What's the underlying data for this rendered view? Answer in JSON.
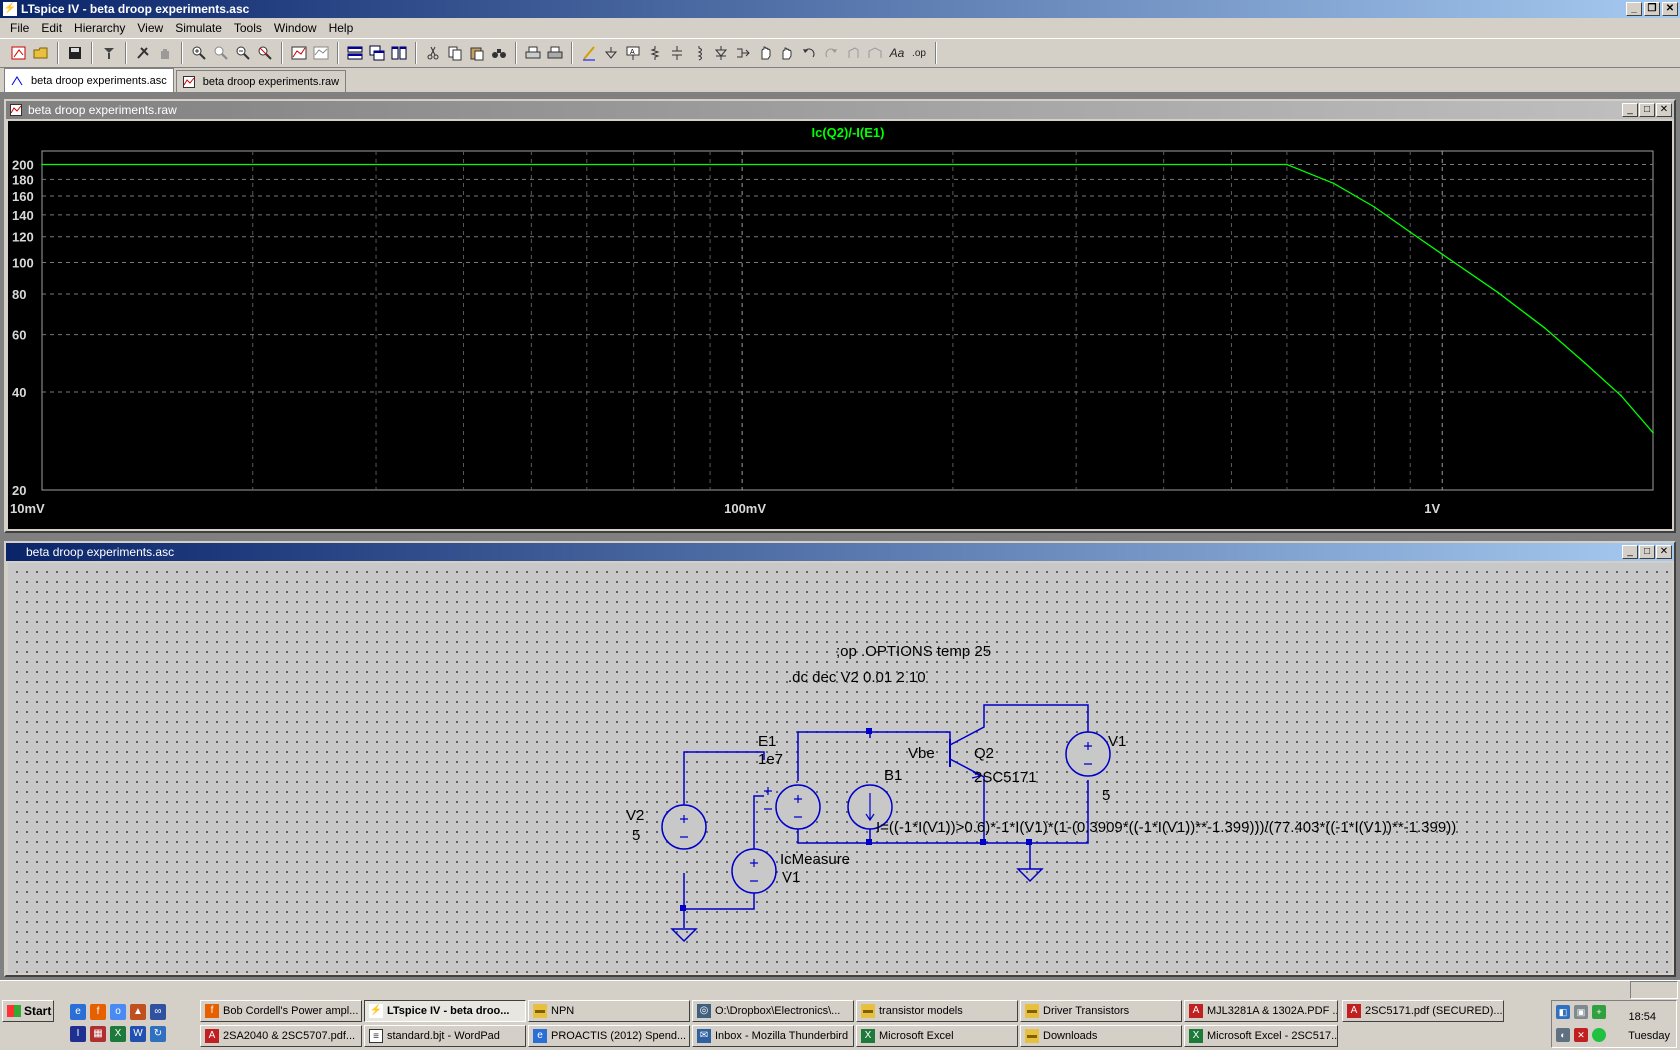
{
  "window": {
    "title": "LTspice IV - beta droop experiments.asc",
    "controls": [
      "_",
      "❐",
      "✕"
    ]
  },
  "menu": [
    "File",
    "Edit",
    "Hierarchy",
    "View",
    "Simulate",
    "Tools",
    "Window",
    "Help"
  ],
  "toolbar": {
    "icons": [
      "run-icon",
      "open-icon",
      "save-icon",
      "control-panel-icon",
      "halt-icon",
      "pan-icon",
      "zoom-in-icon",
      "zoom-fit-icon",
      "zoom-out-icon",
      "zoom-cancel-icon",
      "autorange-icon",
      "waveform-icon",
      "tile-horizontal-icon",
      "cascade-icon",
      "tile-vertical-icon",
      "cut-icon",
      "copy-icon",
      "paste-icon",
      "find-icon",
      "print-setup-icon",
      "print-icon",
      "draw-wire-icon",
      "ground-icon",
      "label-net-icon",
      "resistor-icon",
      "capacitor-icon",
      "inductor-icon",
      "diode-icon",
      "component-icon",
      "move-icon",
      "drag-icon",
      "undo-icon",
      "redo-icon",
      "rotate-icon",
      "mirror-icon",
      "text-icon",
      "spice-directive-icon"
    ],
    "text_glyphs": {
      "text": "Aa",
      "op": ".op"
    }
  },
  "tabs": [
    {
      "label": "beta droop experiments.asc",
      "active": true,
      "icon": "schematic-icon"
    },
    {
      "label": "beta droop experiments.raw",
      "active": false,
      "icon": "waveform-icon"
    }
  ],
  "waveform_window": {
    "title": "beta droop experiments.raw",
    "trace_label": "Ic(Q2)/-I(E1)",
    "trace_color": "#00ff00",
    "y_ticks": [
      "200",
      "180",
      "160",
      "140",
      "120",
      "100",
      "80",
      "60",
      "40",
      "20"
    ],
    "x_ticks": [
      "10mV",
      "100mV",
      "1V"
    ]
  },
  "chart_data": {
    "type": "line",
    "title": "Ic(Q2)/-I(E1)",
    "xlabel": "",
    "ylabel": "",
    "x_scale": "log",
    "y_scale": "log",
    "xlim": [
      0.01,
      2
    ],
    "ylim": [
      20,
      220
    ],
    "grid": true,
    "series": [
      {
        "name": "Ic(Q2)/-I(E1)",
        "color": "#00ff00",
        "x": [
          0.01,
          0.1,
          0.5,
          0.6,
          0.7,
          0.8,
          0.9,
          1.0,
          1.2,
          1.4,
          1.6,
          1.8,
          2.0
        ],
        "y": [
          200,
          200,
          200,
          200,
          175,
          148,
          124,
          106,
          81,
          63,
          49,
          39,
          30
        ]
      }
    ]
  },
  "schematic_window": {
    "title": "beta droop experiments.asc",
    "directives": {
      "op_options": ";op   .OPTIONS temp 25",
      "dc": ".dc dec V2 0.01 2 10"
    },
    "labels": {
      "E1_name": "E1",
      "E1_value": "1e7",
      "B1_name": "B1",
      "vbe_net": "Vbe",
      "Q2_name": "Q2",
      "Q2_model": "2SC5171",
      "V1_name": "V1",
      "V1_value": "5",
      "V2_name": "V2",
      "V2_value": "5",
      "icmeasure_name": "IcMeasure",
      "icmeasure_value": "V1",
      "B1_expr": "I=((-1*I(V1))>0.6)*-1*I(V1)*(1-(0.3909*((-1*I(V1))**-1.399)))/(77.403*((-1*I(V1))**-1.399))"
    },
    "wire_color": "#0000c8"
  },
  "taskbar": {
    "start_label": "Start",
    "buttons_row1": [
      {
        "label": "Bob Cordell's Power ampl...",
        "icon": "firefox-icon"
      },
      {
        "label": "LTspice IV - beta droo...",
        "icon": "ltspice-icon",
        "pressed": true
      },
      {
        "label": "NPN",
        "icon": "folder-icon"
      },
      {
        "label": "O:\\Dropbox\\Electronics\\...",
        "icon": "explorer-icon"
      },
      {
        "label": "transistor models",
        "icon": "folder-icon"
      },
      {
        "label": "Driver Transistors",
        "icon": "folder-icon"
      },
      {
        "label": "MJL3281A & 1302A.PDF ...",
        "icon": "pdf-icon"
      },
      {
        "label": "2SC5171.pdf (SECURED)...",
        "icon": "pdf-icon"
      }
    ],
    "buttons_row2": [
      {
        "label": "2SA2040 & 2SC5707.pdf...",
        "icon": "pdf-icon"
      },
      {
        "label": "standard.bjt - WordPad",
        "icon": "wordpad-icon"
      },
      {
        "label": "PROACTIS (2012) Spend...",
        "icon": "ie-icon"
      },
      {
        "label": "Inbox - Mozilla Thunderbird",
        "icon": "thunderbird-icon"
      },
      {
        "label": "Microsoft Excel",
        "icon": "excel-icon"
      },
      {
        "label": "Downloads",
        "icon": "folder-icon"
      },
      {
        "label": "Microsoft Excel - 2SC517...",
        "icon": "excel-icon"
      }
    ],
    "clock_time": "18:54",
    "clock_day": "Tuesday"
  }
}
